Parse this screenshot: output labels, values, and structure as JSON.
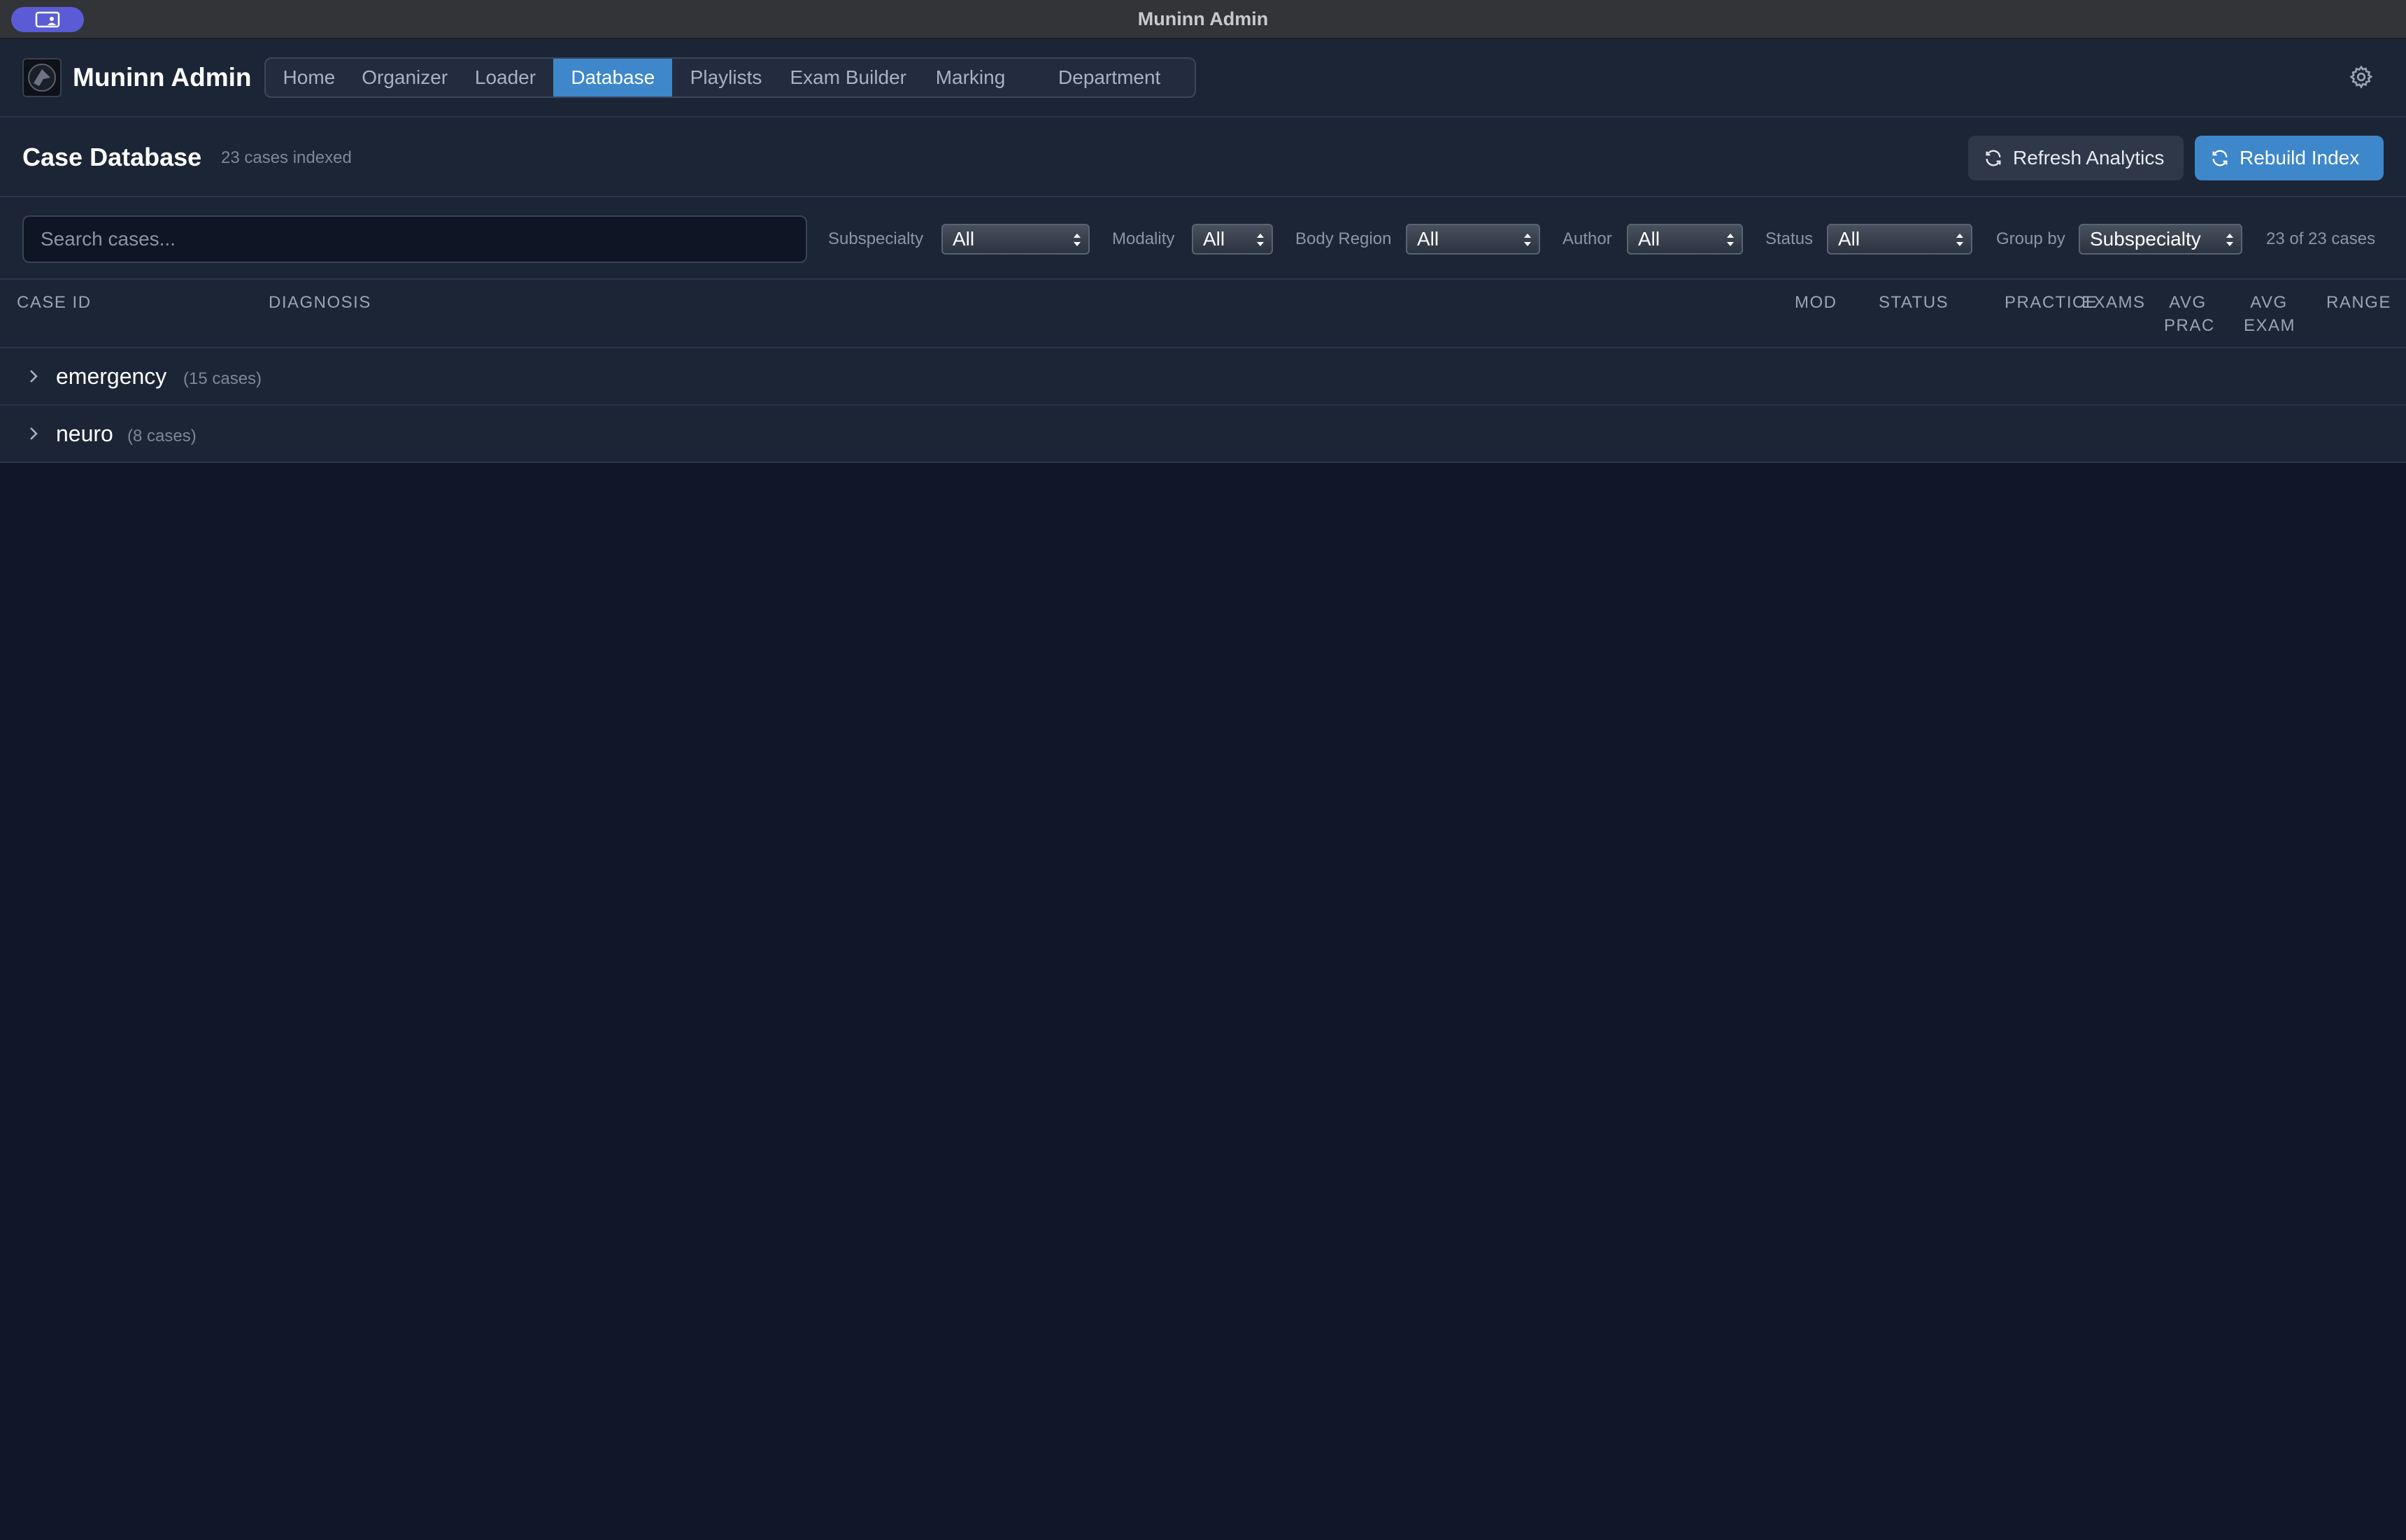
{
  "window": {
    "title": "Muninn Admin"
  },
  "nav": {
    "app_name": "Muninn Admin",
    "tabs": [
      {
        "label": "Home",
        "active": false
      },
      {
        "label": "Organizer",
        "active": false
      },
      {
        "label": "Loader",
        "active": false
      },
      {
        "label": "Database",
        "active": true
      },
      {
        "label": "Playlists",
        "active": false
      },
      {
        "label": "Exam Builder",
        "active": false
      },
      {
        "label": "Marking",
        "active": false
      },
      {
        "label": "Department",
        "active": false
      }
    ],
    "settings_icon": "gear-icon"
  },
  "page": {
    "title": "Case Database",
    "subtitle": "23 cases indexed",
    "refresh_button": "Refresh Analytics",
    "rebuild_button": "Rebuild Index"
  },
  "filters": {
    "search_placeholder": "Search cases...",
    "subspecialty": {
      "label": "Subspecialty",
      "value": "All"
    },
    "modality": {
      "label": "Modality",
      "value": "All"
    },
    "body_region": {
      "label": "Body Region",
      "value": "All"
    },
    "author": {
      "label": "Author",
      "value": "All"
    },
    "status": {
      "label": "Status",
      "value": "All"
    },
    "group_by": {
      "label": "Group by",
      "value": "Subspecialty"
    },
    "result_count": "23 of 23 cases"
  },
  "table": {
    "columns": {
      "case_id": "CASE ID",
      "diagnosis": "DIAGNOSIS",
      "mod": "MOD",
      "status": "STATUS",
      "practice": "PRACTICE",
      "exams": "EXAMS",
      "avg_prac_1": "AVG",
      "avg_prac_2": "PRAC",
      "avg_exam_1": "AVG",
      "avg_exam_2": "EXAM",
      "range": "RANGE"
    },
    "groups": [
      {
        "name": "emergency",
        "count": "(15 cases)"
      },
      {
        "name": "neuro",
        "count": "(8 cases)"
      }
    ]
  },
  "colors": {
    "accent": "#3d87ca",
    "background": "#111729",
    "panel": "#1c2536"
  }
}
